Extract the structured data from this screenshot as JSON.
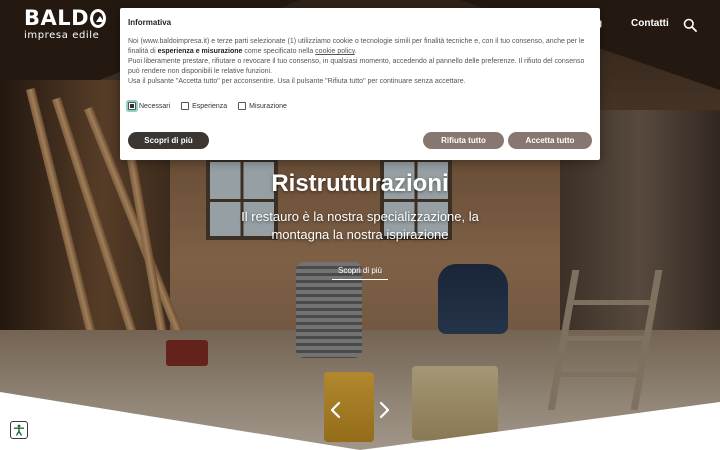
{
  "header": {
    "logo_word": "BALD",
    "logo_subtitle": "impresa edile",
    "nav_partial": "g",
    "nav_contatti": "Contatti",
    "search_icon": "search-icon"
  },
  "hero": {
    "title": "Ristrutturazioni",
    "subtitle_line1": "Il restauro è la nostra specializzazione, la",
    "subtitle_line2": "montagna la nostra ispirazione",
    "cta": "Scopri di più",
    "prev_icon": "chevron-left-icon",
    "next_icon": "chevron-right-icon"
  },
  "cookie": {
    "title": "Informativa",
    "p1_a": "Noi (www.baldoimpresa.it) e terze parti selezionate (1) utilizziamo cookie o tecnologie simili per finalità tecniche e, con il tuo consenso, anche per le finalità di ",
    "p1_bold": "esperienza e misurazione",
    "p1_b": " come specificato nella ",
    "p1_link": "cookie policy",
    "p1_c": ".",
    "p2": "Puoi liberamente prestare, rifiutare o revocare il tuo consenso, in qualsiasi momento, accedendo al pannello delle preferenze. Il rifiuto del consenso può rendere non disponibili le relative funzioni.",
    "p3": "Usa il pulsante \"Accetta tutto\" per acconsentire. Usa il pulsante \"Rifiuta tutto\" per continuare senza accettare.",
    "options": [
      {
        "label": "Necessari",
        "checked": true
      },
      {
        "label": "Esperienza",
        "checked": false
      },
      {
        "label": "Misurazione",
        "checked": false
      }
    ],
    "btn_more": "Scopri di più",
    "btn_reject": "Rifiuta tutto",
    "btn_accept": "Accetta tutto"
  },
  "accessibility_icon": "accessibility-icon",
  "colors": {
    "button_dark": "#3b3632",
    "button_muted": "#877770",
    "focus_ring": "#8fd1c4"
  }
}
